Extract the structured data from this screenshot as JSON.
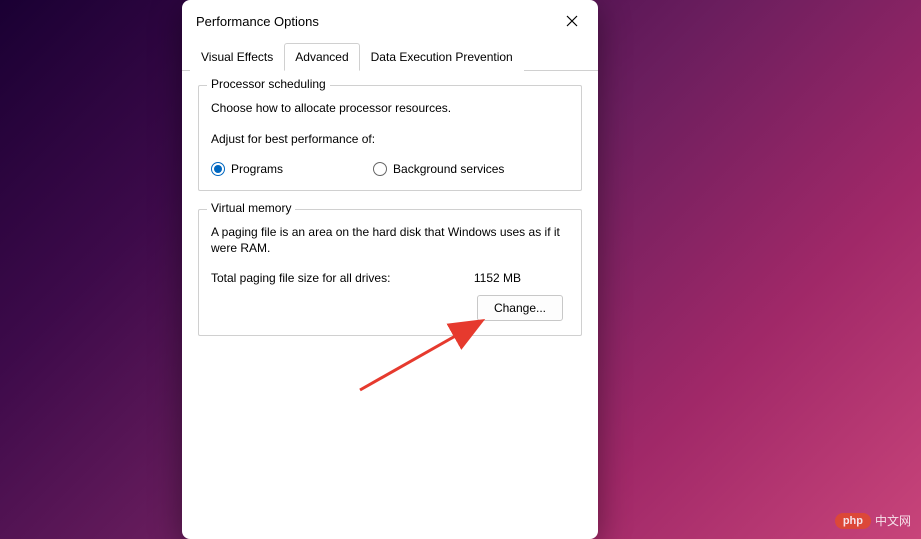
{
  "window": {
    "title": "Performance Options"
  },
  "tabs": {
    "visual_effects": "Visual Effects",
    "advanced": "Advanced",
    "dep": "Data Execution Prevention"
  },
  "processor": {
    "legend": "Processor scheduling",
    "description": "Choose how to allocate processor resources.",
    "adjust_label": "Adjust for best performance of:",
    "option_programs": "Programs",
    "option_background": "Background services"
  },
  "virtual_memory": {
    "legend": "Virtual memory",
    "description": "A paging file is an area on the hard disk that Windows uses as if it were RAM.",
    "total_label": "Total paging file size for all drives:",
    "total_value": "1152 MB",
    "change_button": "Change..."
  },
  "watermark": {
    "brand": "php",
    "text": "中文网"
  }
}
